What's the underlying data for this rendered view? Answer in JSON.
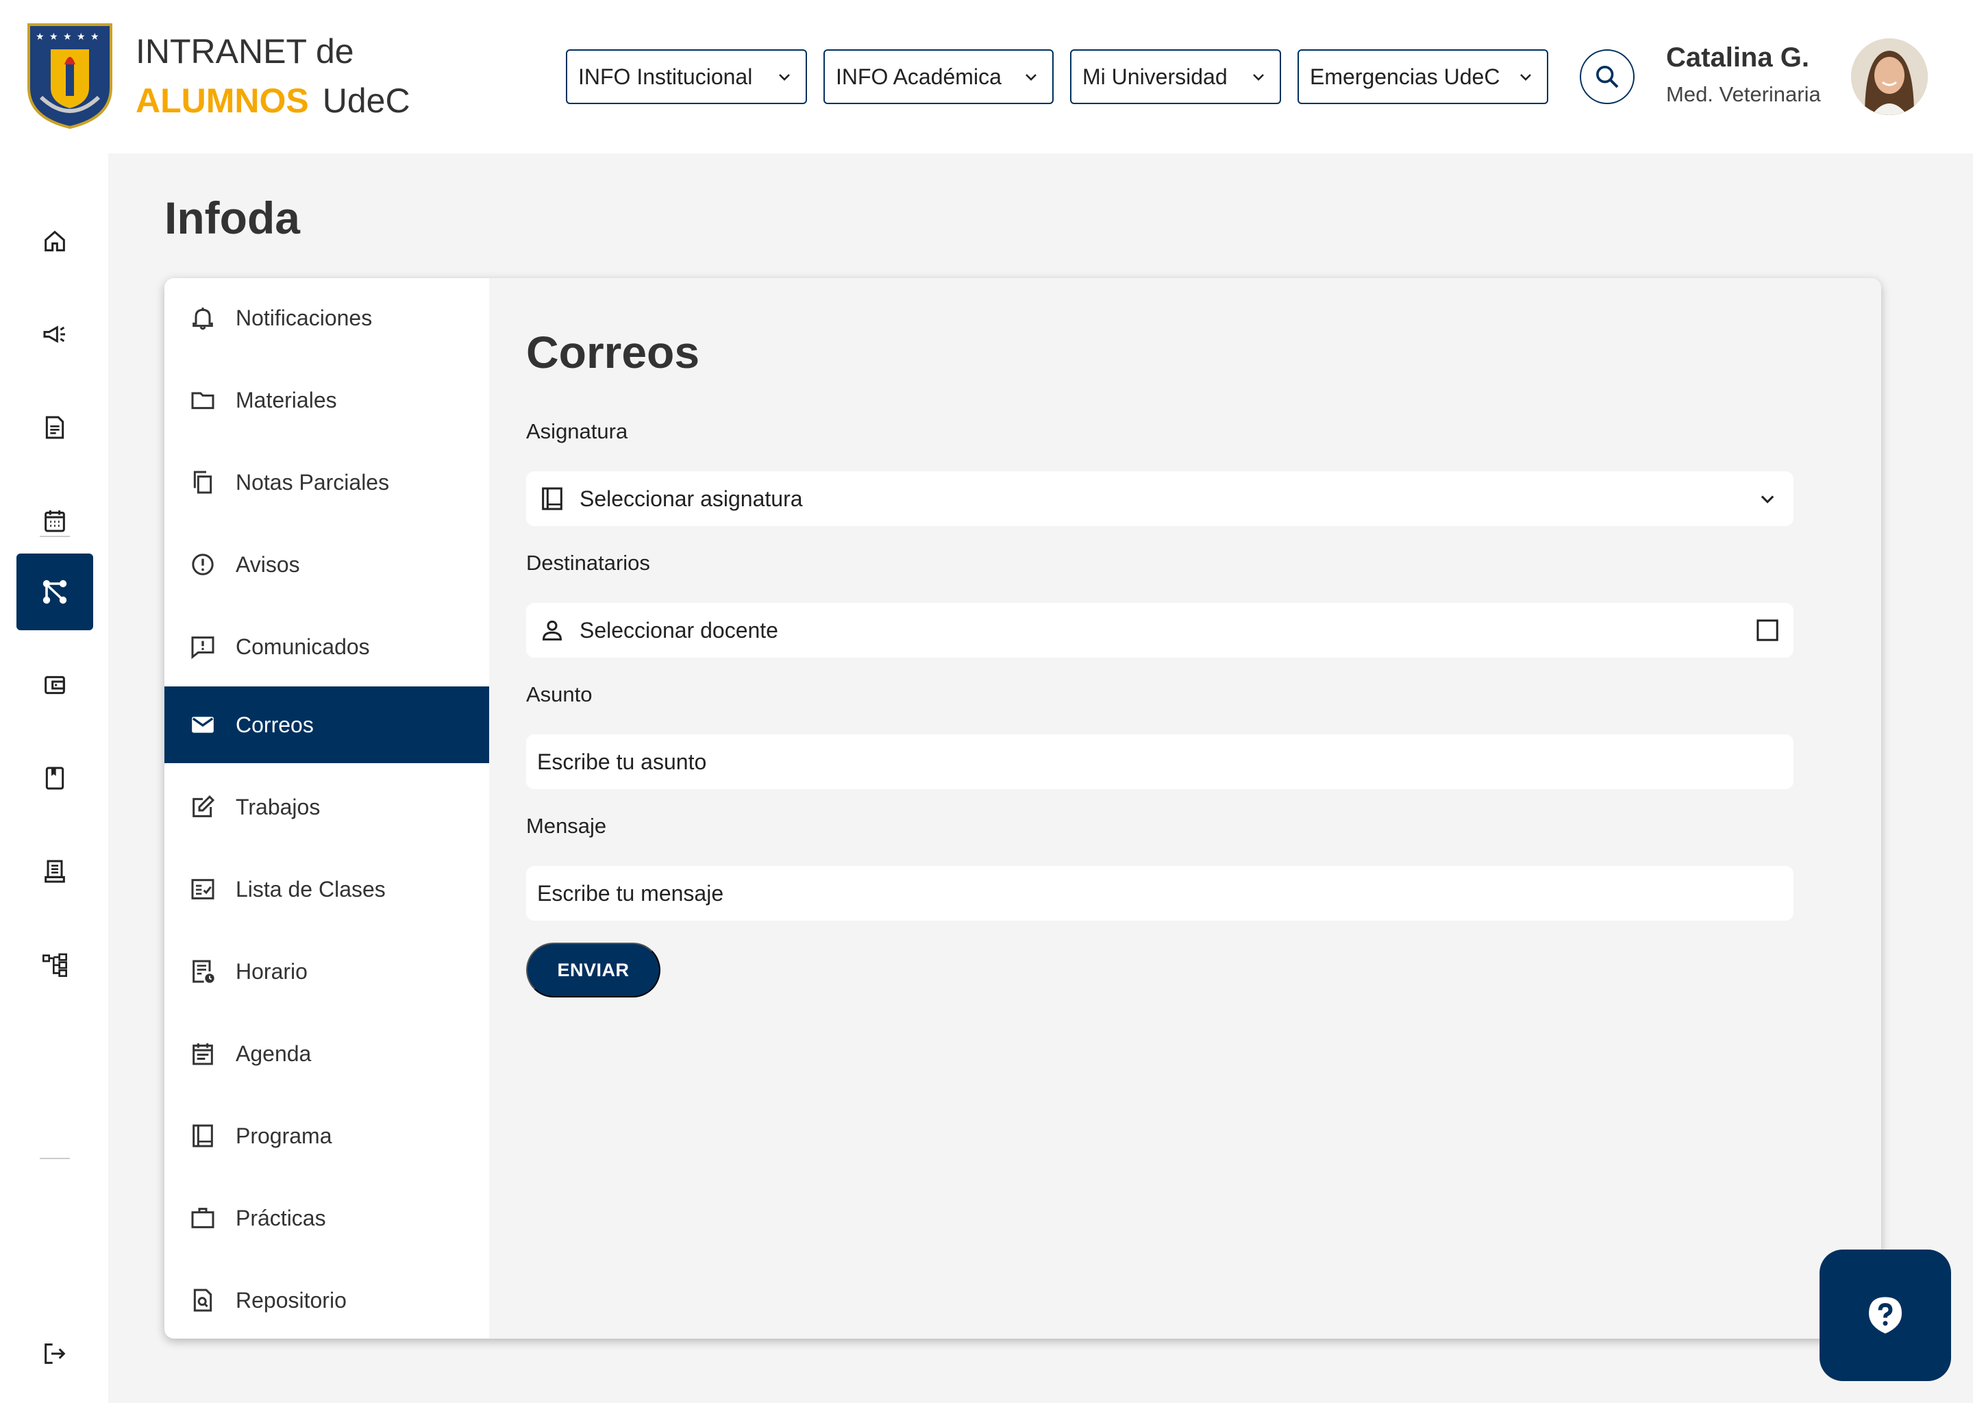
{
  "header": {
    "brand_line1": "INTRANET de",
    "brand_accent": "ALUMNOS",
    "brand_suffix": "UdeC",
    "menus": [
      {
        "label": "INFO Institucional"
      },
      {
        "label": "INFO Académica"
      },
      {
        "label": "Mi Universidad"
      },
      {
        "label": "Emergencias UdeC"
      }
    ],
    "user": {
      "name": "Catalina G.",
      "role": "Med. Veterinaria"
    }
  },
  "rail": {
    "items": [
      {
        "icon": "home-icon"
      },
      {
        "icon": "megaphone-icon"
      },
      {
        "icon": "document-icon"
      },
      {
        "icon": "calendar-icon"
      },
      {
        "icon": "workflow-icon",
        "active": true
      },
      {
        "icon": "wallet-icon"
      },
      {
        "icon": "book-icon"
      },
      {
        "icon": "receipt-icon"
      },
      {
        "icon": "sitemap-icon"
      },
      {
        "icon": "logout-icon"
      }
    ]
  },
  "page": {
    "title": "Infoda"
  },
  "subnav": {
    "items": [
      {
        "label": "Notificaciones",
        "icon": "bell-icon"
      },
      {
        "label": "Materiales",
        "icon": "folder-icon"
      },
      {
        "label": "Notas Parciales",
        "icon": "copy-icon"
      },
      {
        "label": "Avisos",
        "icon": "alert-circle-icon"
      },
      {
        "label": "Comunicados",
        "icon": "message-alert-icon"
      },
      {
        "label": "Correos",
        "icon": "mail-icon",
        "active": true
      },
      {
        "label": "Trabajos",
        "icon": "edit-icon"
      },
      {
        "label": "Lista de Clases",
        "icon": "checklist-icon"
      },
      {
        "label": "Horario",
        "icon": "schedule-icon"
      },
      {
        "label": "Agenda",
        "icon": "agenda-icon"
      },
      {
        "label": "Programa",
        "icon": "book-open-icon"
      },
      {
        "label": "Prácticas",
        "icon": "briefcase-icon"
      },
      {
        "label": "Repositorio",
        "icon": "file-search-icon"
      }
    ]
  },
  "form": {
    "title": "Correos",
    "asignatura_label": "Asignatura",
    "asignatura_value": "Seleccionar asignatura",
    "destinatarios_label": "Destinatarios",
    "destinatarios_value": "Seleccionar docente",
    "asunto_label": "Asunto",
    "asunto_placeholder": "Escribe tu asunto",
    "mensaje_label": "Mensaje",
    "mensaje_placeholder": "Escribe tu mensaje",
    "send_label": "ENVIAR"
  },
  "colors": {
    "primary": "#00305e",
    "accent": "#f5a800",
    "background": "#f4f4f4"
  }
}
